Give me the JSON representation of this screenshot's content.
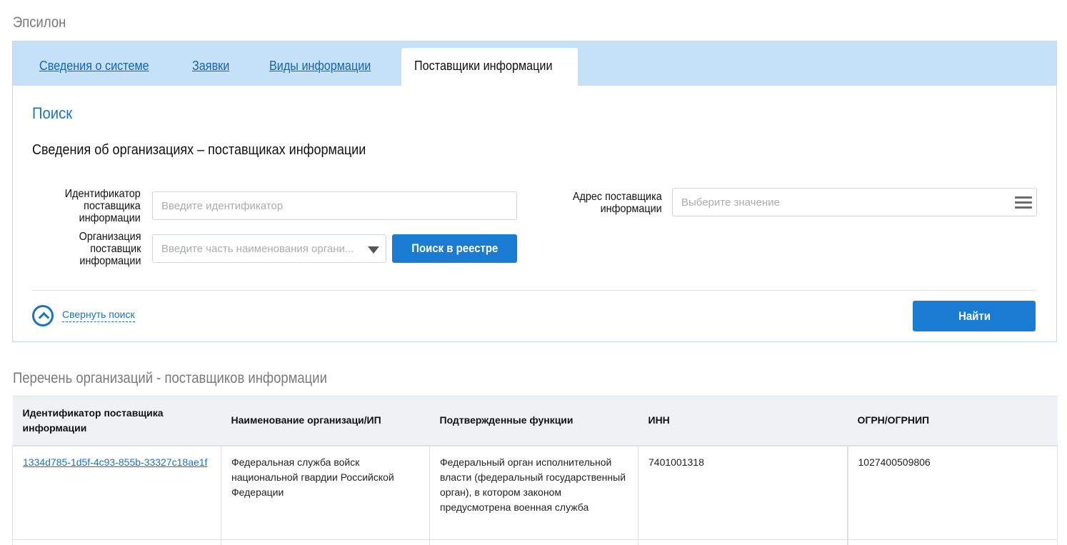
{
  "app_title": "Эпсилон",
  "tabs": [
    {
      "label": "Сведения о системе"
    },
    {
      "label": "Заявки"
    },
    {
      "label": "Виды информации"
    },
    {
      "label": "Поставщики информации"
    }
  ],
  "search": {
    "heading": "Поиск",
    "section_title": "Сведения об организациях – поставщиках информации",
    "id_field": {
      "label_lines": [
        "Идентификатор",
        "поставщика",
        "информации"
      ],
      "placeholder": "Введите идентификатор",
      "value": ""
    },
    "org_field": {
      "label_lines": [
        "Организация",
        "поставщик",
        "информации"
      ],
      "placeholder": "Введите часть наименования органи..."
    },
    "registry_button": "Поиск в реестре",
    "address_field": {
      "label_lines": [
        "Адрес поставщика",
        "информации"
      ],
      "placeholder": "Выберите значение"
    },
    "collapse_link": "Свернуть поиск",
    "find_button": "Найти"
  },
  "list": {
    "title": "Перечень организаций - поставщиков информации",
    "columns": [
      "Идентификатор поставщика информации",
      "Наименование организаци/ИП",
      "Подтвержденные функции",
      "ИНН",
      "ОГРН/ОГРНИП"
    ],
    "rows": [
      {
        "id": "1334d785-1d5f-4c93-855b-33327c18ae1f",
        "name": "Федеральная служба войск национальной гвардии Российской Федерации",
        "functions": "Федеральный орган исполнительной власти (федеральный государственный орган), в котором законом предусмотрена военная служба",
        "inn": "7401001318",
        "ogrn": "1027400509806"
      }
    ]
  },
  "colors": {
    "accent": "#1a7bd3",
    "tabbar": "#c4e1f7",
    "link": "#1565b0"
  }
}
